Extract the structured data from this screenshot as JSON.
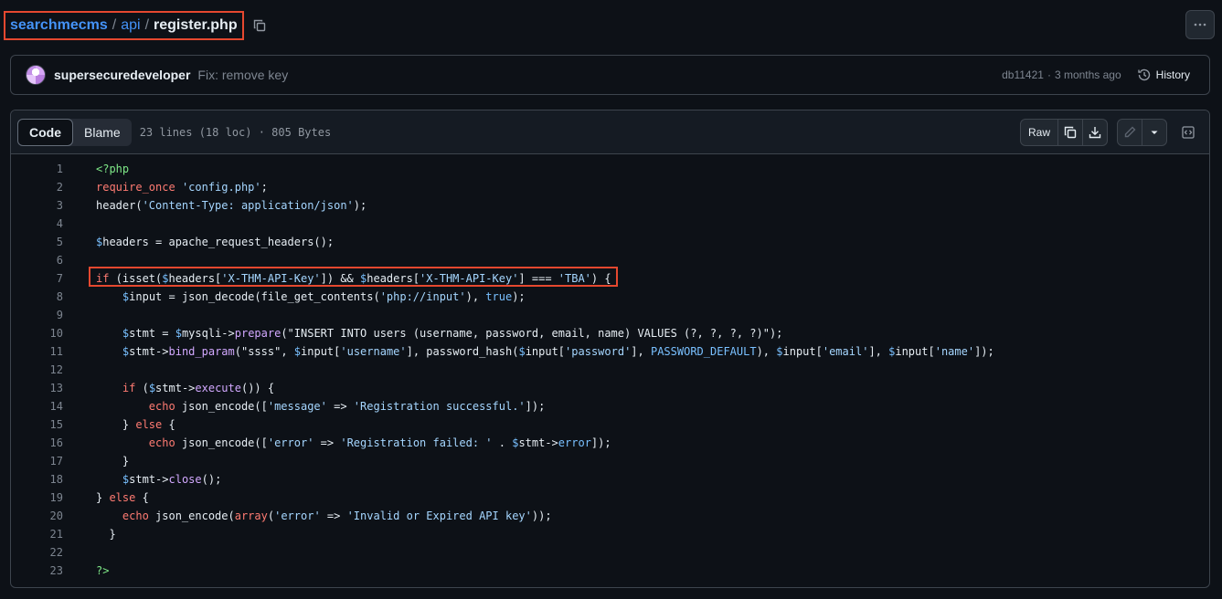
{
  "breadcrumb": {
    "repo": "searchmecms",
    "sep1": "/",
    "folder": "api",
    "sep2": "/",
    "file": "register.php"
  },
  "commit": {
    "author": "supersecuredeveloper",
    "message": "Fix: remove key",
    "hash": "db11421",
    "dot": "·",
    "time": "3 months ago",
    "history_label": "History"
  },
  "code_view": {
    "tabs": [
      {
        "label": "Code",
        "active": true
      },
      {
        "label": "Blame",
        "active": false
      }
    ],
    "file_info": "23 lines (18 loc) · 805 Bytes",
    "raw_label": "Raw"
  },
  "code_lines": [
    {
      "n": "1",
      "segs": [
        {
          "t": "<?php",
          "c": "php"
        }
      ]
    },
    {
      "n": "2",
      "segs": [
        {
          "t": "require_once",
          "c": "kw"
        },
        {
          "t": " ",
          "c": ""
        },
        {
          "t": "'config.php'",
          "c": "str"
        },
        {
          "t": ";",
          "c": ""
        }
      ]
    },
    {
      "n": "3",
      "segs": [
        {
          "t": "header(",
          "c": ""
        },
        {
          "t": "'Content-Type: application/json'",
          "c": "str"
        },
        {
          "t": ");",
          "c": ""
        }
      ]
    },
    {
      "n": "4",
      "segs": []
    },
    {
      "n": "5",
      "segs": [
        {
          "t": "$",
          "c": "var"
        },
        {
          "t": "headers = apache_request_headers();",
          "c": ""
        }
      ]
    },
    {
      "n": "6",
      "segs": []
    },
    {
      "n": "7",
      "segs": [
        {
          "t": "if",
          "c": "kw"
        },
        {
          "t": " (isset(",
          "c": ""
        },
        {
          "t": "$",
          "c": "var"
        },
        {
          "t": "headers[",
          "c": ""
        },
        {
          "t": "'X-THM-API-Key'",
          "c": "str"
        },
        {
          "t": "]) && ",
          "c": ""
        },
        {
          "t": "$",
          "c": "var"
        },
        {
          "t": "headers[",
          "c": ""
        },
        {
          "t": "'X-THM-API-Key'",
          "c": "str"
        },
        {
          "t": "] === ",
          "c": ""
        },
        {
          "t": "'TBA'",
          "c": "str"
        },
        {
          "t": ") {",
          "c": ""
        }
      ]
    },
    {
      "n": "8",
      "segs": [
        {
          "t": "    ",
          "c": ""
        },
        {
          "t": "$",
          "c": "var"
        },
        {
          "t": "input = json_decode(file_get_contents(",
          "c": ""
        },
        {
          "t": "'php://input'",
          "c": "str"
        },
        {
          "t": "), ",
          "c": ""
        },
        {
          "t": "true",
          "c": "var"
        },
        {
          "t": ");",
          "c": ""
        }
      ]
    },
    {
      "n": "9",
      "segs": []
    },
    {
      "n": "10",
      "segs": [
        {
          "t": "    ",
          "c": ""
        },
        {
          "t": "$",
          "c": "var"
        },
        {
          "t": "stmt = ",
          "c": ""
        },
        {
          "t": "$",
          "c": "var"
        },
        {
          "t": "mysqli->",
          "c": ""
        },
        {
          "t": "prepare",
          "c": "fn"
        },
        {
          "t": "(\"INSERT INTO users (username, password, email, name) VALUES (?, ?, ?, ?)\");",
          "c": ""
        }
      ]
    },
    {
      "n": "11",
      "segs": [
        {
          "t": "    ",
          "c": ""
        },
        {
          "t": "$",
          "c": "var"
        },
        {
          "t": "stmt->",
          "c": ""
        },
        {
          "t": "bind_param",
          "c": "fn"
        },
        {
          "t": "(\"ssss\", ",
          "c": ""
        },
        {
          "t": "$",
          "c": "var"
        },
        {
          "t": "input[",
          "c": ""
        },
        {
          "t": "'username'",
          "c": "str"
        },
        {
          "t": "], password_hash(",
          "c": ""
        },
        {
          "t": "$",
          "c": "var"
        },
        {
          "t": "input[",
          "c": ""
        },
        {
          "t": "'password'",
          "c": "str"
        },
        {
          "t": "], ",
          "c": ""
        },
        {
          "t": "PASSWORD_DEFAULT",
          "c": "var"
        },
        {
          "t": "), ",
          "c": ""
        },
        {
          "t": "$",
          "c": "var"
        },
        {
          "t": "input[",
          "c": ""
        },
        {
          "t": "'email'",
          "c": "str"
        },
        {
          "t": "], ",
          "c": ""
        },
        {
          "t": "$",
          "c": "var"
        },
        {
          "t": "input[",
          "c": ""
        },
        {
          "t": "'name'",
          "c": "str"
        },
        {
          "t": "]);",
          "c": ""
        }
      ]
    },
    {
      "n": "12",
      "segs": []
    },
    {
      "n": "13",
      "segs": [
        {
          "t": "    ",
          "c": ""
        },
        {
          "t": "if",
          "c": "kw"
        },
        {
          "t": " (",
          "c": ""
        },
        {
          "t": "$",
          "c": "var"
        },
        {
          "t": "stmt->",
          "c": ""
        },
        {
          "t": "execute",
          "c": "fn"
        },
        {
          "t": "()) {",
          "c": ""
        }
      ]
    },
    {
      "n": "14",
      "segs": [
        {
          "t": "        ",
          "c": ""
        },
        {
          "t": "echo",
          "c": "kw"
        },
        {
          "t": " json_encode([",
          "c": ""
        },
        {
          "t": "'message'",
          "c": "str"
        },
        {
          "t": " => ",
          "c": ""
        },
        {
          "t": "'Registration successful.'",
          "c": "str"
        },
        {
          "t": "]);",
          "c": ""
        }
      ]
    },
    {
      "n": "15",
      "segs": [
        {
          "t": "    } ",
          "c": ""
        },
        {
          "t": "else",
          "c": "kw"
        },
        {
          "t": " {",
          "c": ""
        }
      ]
    },
    {
      "n": "16",
      "segs": [
        {
          "t": "        ",
          "c": ""
        },
        {
          "t": "echo",
          "c": "kw"
        },
        {
          "t": " json_encode([",
          "c": ""
        },
        {
          "t": "'error'",
          "c": "str"
        },
        {
          "t": " => ",
          "c": ""
        },
        {
          "t": "'Registration failed: '",
          "c": "str"
        },
        {
          "t": " . ",
          "c": ""
        },
        {
          "t": "$",
          "c": "var"
        },
        {
          "t": "stmt->",
          "c": ""
        },
        {
          "t": "error",
          "c": "var"
        },
        {
          "t": "]);",
          "c": ""
        }
      ]
    },
    {
      "n": "17",
      "segs": [
        {
          "t": "    }",
          "c": ""
        }
      ]
    },
    {
      "n": "18",
      "segs": [
        {
          "t": "    ",
          "c": ""
        },
        {
          "t": "$",
          "c": "var"
        },
        {
          "t": "stmt->",
          "c": ""
        },
        {
          "t": "close",
          "c": "fn"
        },
        {
          "t": "();",
          "c": ""
        }
      ]
    },
    {
      "n": "19",
      "segs": [
        {
          "t": "} ",
          "c": ""
        },
        {
          "t": "else",
          "c": "kw"
        },
        {
          "t": " {",
          "c": ""
        }
      ]
    },
    {
      "n": "20",
      "segs": [
        {
          "t": "    ",
          "c": ""
        },
        {
          "t": "echo",
          "c": "kw"
        },
        {
          "t": " json_encode(",
          "c": ""
        },
        {
          "t": "array",
          "c": "kw"
        },
        {
          "t": "(",
          "c": ""
        },
        {
          "t": "'error'",
          "c": "str"
        },
        {
          "t": " => ",
          "c": ""
        },
        {
          "t": "'Invalid or Expired API key'",
          "c": "str"
        },
        {
          "t": "));",
          "c": ""
        }
      ]
    },
    {
      "n": "21",
      "segs": [
        {
          "t": "  }",
          "c": ""
        }
      ]
    },
    {
      "n": "22",
      "segs": []
    },
    {
      "n": "23",
      "segs": [
        {
          "t": "?>",
          "c": "php"
        }
      ]
    }
  ],
  "colors": {
    "background": "#0d1117",
    "link": "#4493f8",
    "highlight_box": "#e5482f",
    "keyword": "#ff7b72",
    "string": "#a5d6ff",
    "variable": "#79c0ff",
    "function": "#d2a8ff",
    "php_tag": "#7ee787"
  },
  "icons": [
    "copy-path-icon",
    "kebab-icon",
    "avatar",
    "history-icon",
    "copy-icon",
    "download-icon",
    "pencil-icon",
    "triangle-down-icon",
    "code-symbols-icon"
  ]
}
